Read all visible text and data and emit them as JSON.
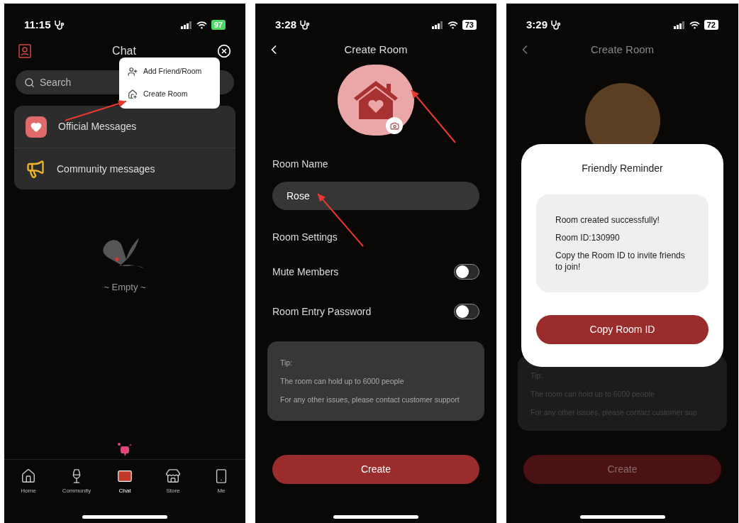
{
  "chat_screen": {
    "status": {
      "time": "11:15",
      "battery": "97",
      "charging": true
    },
    "title": "Chat",
    "search": {
      "placeholder": "Search"
    },
    "menu": [
      {
        "label": "Add Friend/Room"
      },
      {
        "label": "Create Room"
      }
    ],
    "threads": [
      {
        "title": "Official Messages"
      },
      {
        "title": "Community messages"
      }
    ],
    "empty_text": "~ Empty ~",
    "nav": [
      {
        "label": "Home",
        "selected": false
      },
      {
        "label": "Community",
        "selected": false
      },
      {
        "label": "Chat",
        "selected": true
      },
      {
        "label": "Store",
        "selected": false
      },
      {
        "label": "Me",
        "selected": false
      }
    ]
  },
  "create_room_screen": {
    "status": {
      "time": "3:28",
      "battery": "73",
      "charging": false
    },
    "title": "Create Room",
    "room_name_label": "Room Name",
    "room_name_field": {
      "value": "Rose"
    },
    "settings_heading": "Room Settings",
    "settings": [
      {
        "label": "Mute Members",
        "on": false
      },
      {
        "label": "Room Entry Password",
        "on": false
      }
    ],
    "tip": [
      "Tip:",
      "The room can hold up to 6000 people",
      "For any other issues, please contact customer support"
    ],
    "create_button": "Create"
  },
  "reminder_screen": {
    "status": {
      "time": "3:29",
      "battery": "72",
      "charging": false
    },
    "title": "Create Room",
    "dialog": {
      "title": "Friendly Reminder",
      "message": [
        "Room created successfully!",
        "Room ID:130990",
        "Copy the Room ID to invite friends to join!"
      ],
      "button": "Copy Room ID"
    },
    "tip": [
      "Tip:",
      "The room can hold up to 6000 people",
      "For any other issues, please contact customer sup"
    ],
    "create_button": "Create"
  }
}
